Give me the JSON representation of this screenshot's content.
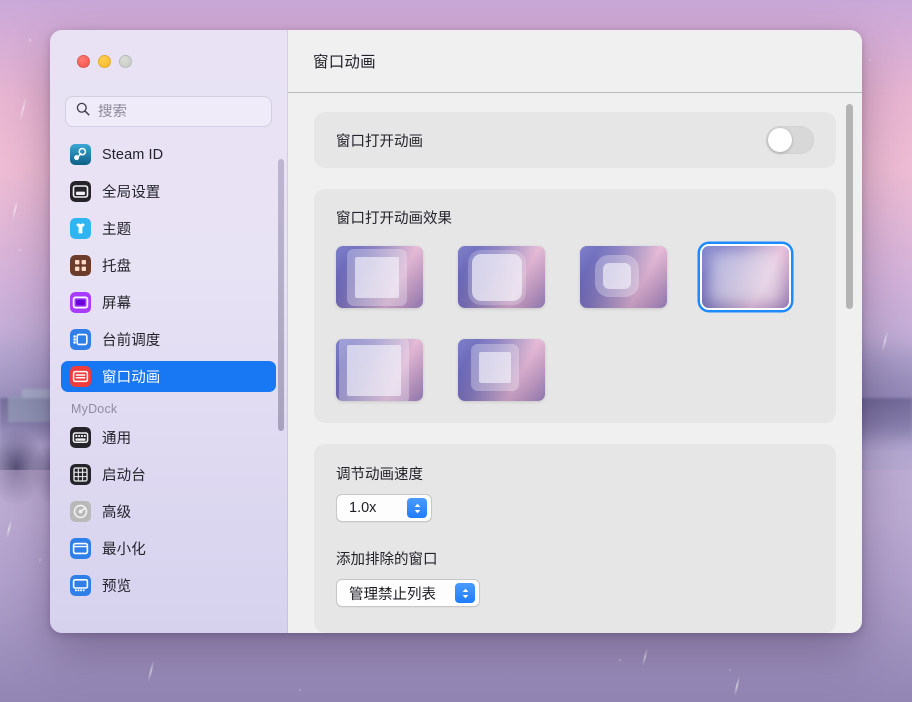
{
  "window": {
    "traffic_lights": [
      {
        "name": "close",
        "label": "Close",
        "color": "#f2544c"
      },
      {
        "name": "minimize",
        "label": "Minimize",
        "color": "#f7b828"
      },
      {
        "name": "zoom",
        "label": "Zoom",
        "color": "#c7cac4"
      }
    ]
  },
  "sidebar": {
    "search": {
      "placeholder": "搜索",
      "value": ""
    },
    "items": [
      {
        "label": "Steam ID",
        "icon": "steam-icon",
        "selected": false
      },
      {
        "label": "全局设置",
        "icon": "global-settings-icon",
        "selected": false
      },
      {
        "label": "主题",
        "icon": "theme-icon",
        "selected": false
      },
      {
        "label": "托盘",
        "icon": "tray-icon",
        "selected": false
      },
      {
        "label": "屏幕",
        "icon": "display-icon",
        "selected": false
      },
      {
        "label": "台前调度",
        "icon": "stage-manager-icon",
        "selected": false
      },
      {
        "label": "窗口动画",
        "icon": "window-animation-icon",
        "selected": true
      }
    ],
    "group_label": "MyDock",
    "group_items": [
      {
        "label": "通用",
        "icon": "general-icon",
        "selected": false
      },
      {
        "label": "启动台",
        "icon": "launchpad-icon",
        "selected": false
      },
      {
        "label": "高级",
        "icon": "advanced-icon",
        "selected": false
      },
      {
        "label": "最小化",
        "icon": "minimize-icon",
        "selected": false
      },
      {
        "label": "预览",
        "icon": "preview-icon",
        "selected": false
      }
    ]
  },
  "main": {
    "title": "窗口动画",
    "toggle_row": {
      "label": "窗口打开动画",
      "enabled": false
    },
    "effects": {
      "title": "窗口打开动画效果",
      "selected_index": 3,
      "thumbnails": [
        {
          "variant": "v1",
          "selected": false
        },
        {
          "variant": "v2",
          "selected": false
        },
        {
          "variant": "v3",
          "selected": false
        },
        {
          "variant": "v4",
          "selected": true
        },
        {
          "variant": "v5",
          "selected": false
        },
        {
          "variant": "v6",
          "selected": false
        }
      ]
    },
    "speed": {
      "label": "调节动画速度",
      "value": "1.0x"
    },
    "exclude": {
      "label": "添加排除的窗口",
      "value": "管理禁止列表"
    }
  },
  "colors": {
    "accent_blue": "#1877f2",
    "selection_ring": "#1d8bff",
    "sidebar_bg": "#e7e2f4",
    "main_bg": "#f0f0f0",
    "card_bg": "#e6e6e6"
  }
}
